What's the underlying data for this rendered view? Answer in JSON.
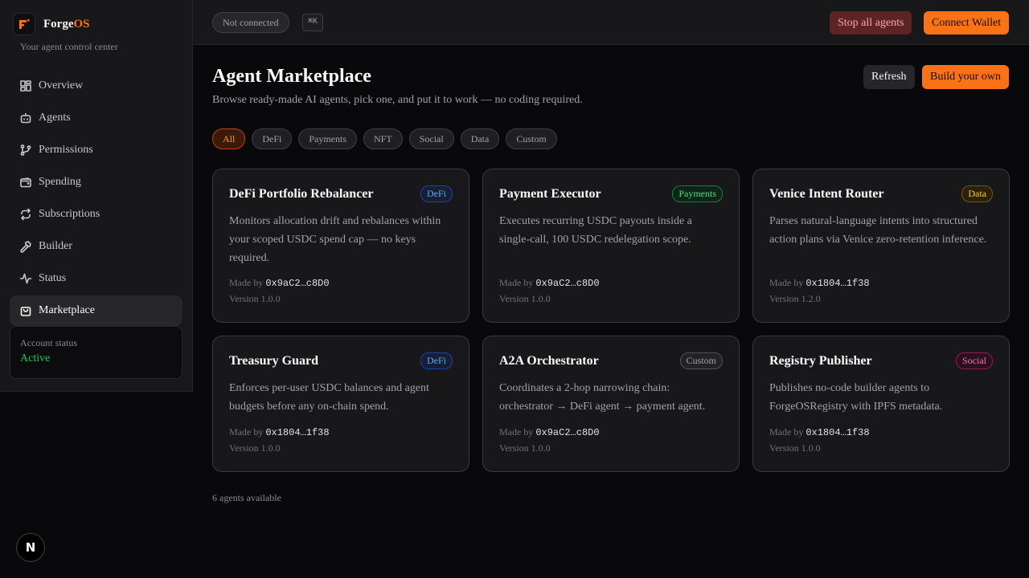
{
  "brand": {
    "name_main": "Forge",
    "name_accent": "OS",
    "tagline": "Your agent control center"
  },
  "sidebar": {
    "items": [
      {
        "label": "Overview",
        "icon": "grid-icon"
      },
      {
        "label": "Agents",
        "icon": "bot-icon"
      },
      {
        "label": "Permissions",
        "icon": "branch-icon"
      },
      {
        "label": "Spending",
        "icon": "wallet-icon"
      },
      {
        "label": "Subscriptions",
        "icon": "repeat-icon"
      },
      {
        "label": "Builder",
        "icon": "hammer-icon"
      },
      {
        "label": "Status",
        "icon": "activity-icon"
      },
      {
        "label": "Marketplace",
        "icon": "shopping-bag-icon",
        "active": true
      }
    ],
    "account": {
      "label": "Account status",
      "value": "Active"
    }
  },
  "topbar": {
    "status": "Not connected",
    "shortcut": "⌘K",
    "stop_label": "Stop all agents",
    "wallet_label": "Connect Wallet"
  },
  "main": {
    "title": "Agent Marketplace",
    "subtitle": "Browse ready-made AI agents, pick one, and put it to work — no coding required.",
    "refresh_label": "Refresh",
    "build_label": "Build your own",
    "filters": [
      "All",
      "DeFi",
      "Payments",
      "NFT",
      "Social",
      "Data",
      "Custom"
    ],
    "active_filter": "All",
    "made_by_label": "Made by",
    "cards": [
      {
        "title": "DeFi Portfolio Rebalancer",
        "category": "DeFi",
        "description": "Monitors allocation drift and rebalances within your scoped USDC spend cap — no keys required.",
        "author": "0x9aC2…c8D0",
        "version": "Version 1.0.0"
      },
      {
        "title": "Payment Executor",
        "category": "Payments",
        "description": "Executes recurring USDC payouts inside a single-call, 100 USDC redelegation scope.",
        "author": "0x9aC2…c8D0",
        "version": "Version 1.0.0"
      },
      {
        "title": "Venice Intent Router",
        "category": "Data",
        "description": "Parses natural-language intents into structured action plans via Venice zero-retention inference.",
        "author": "0x1804…1f38",
        "version": "Version 1.2.0"
      },
      {
        "title": "Treasury Guard",
        "category": "DeFi",
        "description": "Enforces per-user USDC balances and agent budgets before any on-chain spend.",
        "author": "0x1804…1f38",
        "version": "Version 1.0.0"
      },
      {
        "title": "A2A Orchestrator",
        "category": "Custom",
        "description": "Coordinates a 2-hop narrowing chain: orchestrator → DeFi agent → payment agent.",
        "author": "0x9aC2…c8D0",
        "version": "Version 1.0.0"
      },
      {
        "title": "Registry Publisher",
        "category": "Social",
        "description": "Publishes no-code builder agents to ForgeOSRegistry with IPFS metadata.",
        "author": "0x1804…1f38",
        "version": "Version 1.0.0"
      }
    ],
    "count_text": "6 agents available"
  },
  "dev_badge": "N",
  "colors": {
    "accent": "#f97316",
    "active": "#22c55e",
    "background": "#09090b"
  }
}
